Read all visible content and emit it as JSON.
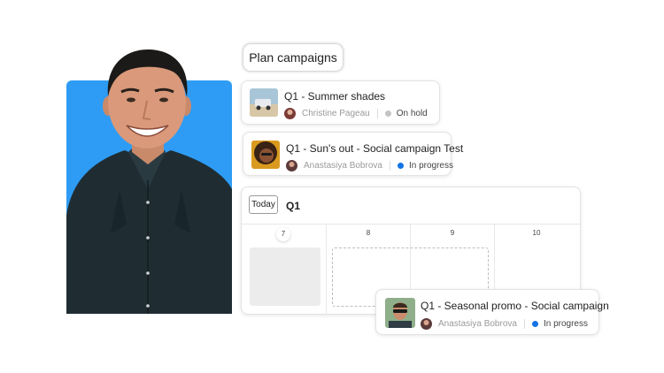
{
  "pill": {
    "label": "Plan campaigns"
  },
  "tasks": [
    {
      "title": "Q1 - Summer shades",
      "assignee": "Christine Pageau",
      "status": "On hold",
      "status_color": "#c4c4c4"
    },
    {
      "title": "Q1 - Sun's out - Social campaign Test",
      "assignee": "Anastasiya Bobrova",
      "status": "In progress",
      "status_color": "#1473e6"
    },
    {
      "title": "Q1 - Seasonal promo - Social campaign",
      "assignee": "Anastasiya Bobrova",
      "status": "In progress",
      "status_color": "#1473e6"
    }
  ],
  "calendar": {
    "today_label": "Today",
    "period": "Q1",
    "days": [
      "7",
      "8",
      "9",
      "10"
    ]
  },
  "colors": {
    "hero_background": "#2e9cf5",
    "accent": "#1473e6"
  }
}
